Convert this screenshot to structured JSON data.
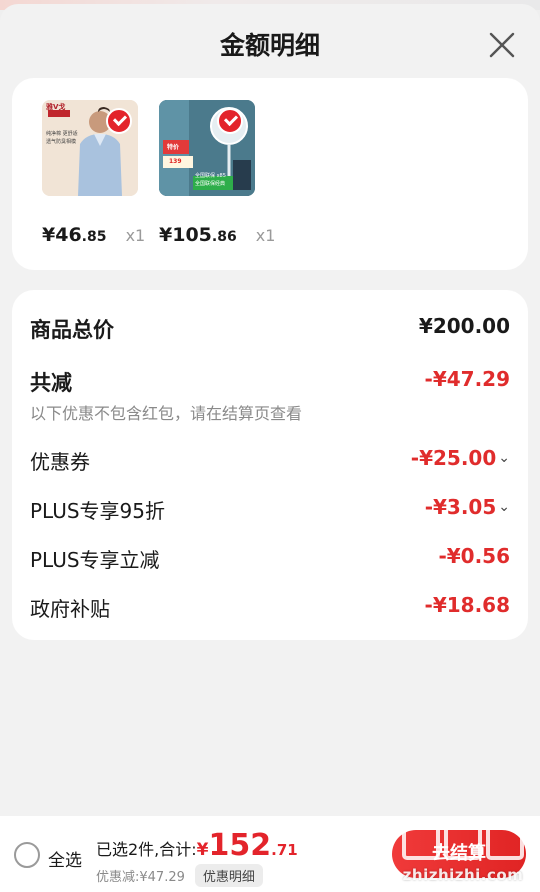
{
  "sheet": {
    "title": "金额明细"
  },
  "products": [
    {
      "price_int": "¥46",
      "price_dec": ".85",
      "qty": "x1"
    },
    {
      "price_int": "¥105",
      "price_dec": ".86",
      "qty": "x1"
    }
  ],
  "product_thumb_text": {
    "p1_brand": "雅V戈",
    "p1_line1": "纯净棉 更舒适",
    "p1_line2": "透气防臭相模",
    "p2_tag": "特价",
    "p2_price": "139",
    "p2_badge": "全国联保 x85",
    "p2_sub": "全国联保经典"
  },
  "detail": {
    "total_label": "商品总价",
    "total_value": "¥200.00",
    "reduce_label": "共减",
    "reduce_value": "-¥47.29",
    "note": "以下优惠不包含红包，请在结算页查看",
    "items": [
      {
        "label": "优惠券",
        "value": "-¥25.00",
        "expandable": true
      },
      {
        "label": "PLUS专享95折",
        "value": "-¥3.05",
        "expandable": true
      },
      {
        "label": "PLUS专享立减",
        "value": "-¥0.56",
        "expandable": false
      },
      {
        "label": "政府补贴",
        "value": "-¥18.68",
        "expandable": false
      }
    ]
  },
  "bottom": {
    "select_all": "全选",
    "selected_text": "已选2件,合计:",
    "total_currency": "¥",
    "total_int": "152",
    "total_dec": ".71",
    "discount_text": "优惠减:¥47.29",
    "detail_button": "优惠明细",
    "checkout_button": "去结算"
  },
  "watermark": {
    "text": "zhizhizhi.com",
    "logo": "值值值"
  },
  "colors": {
    "accent": "#e3242b",
    "background": "#efefef",
    "card": "#ffffff"
  }
}
